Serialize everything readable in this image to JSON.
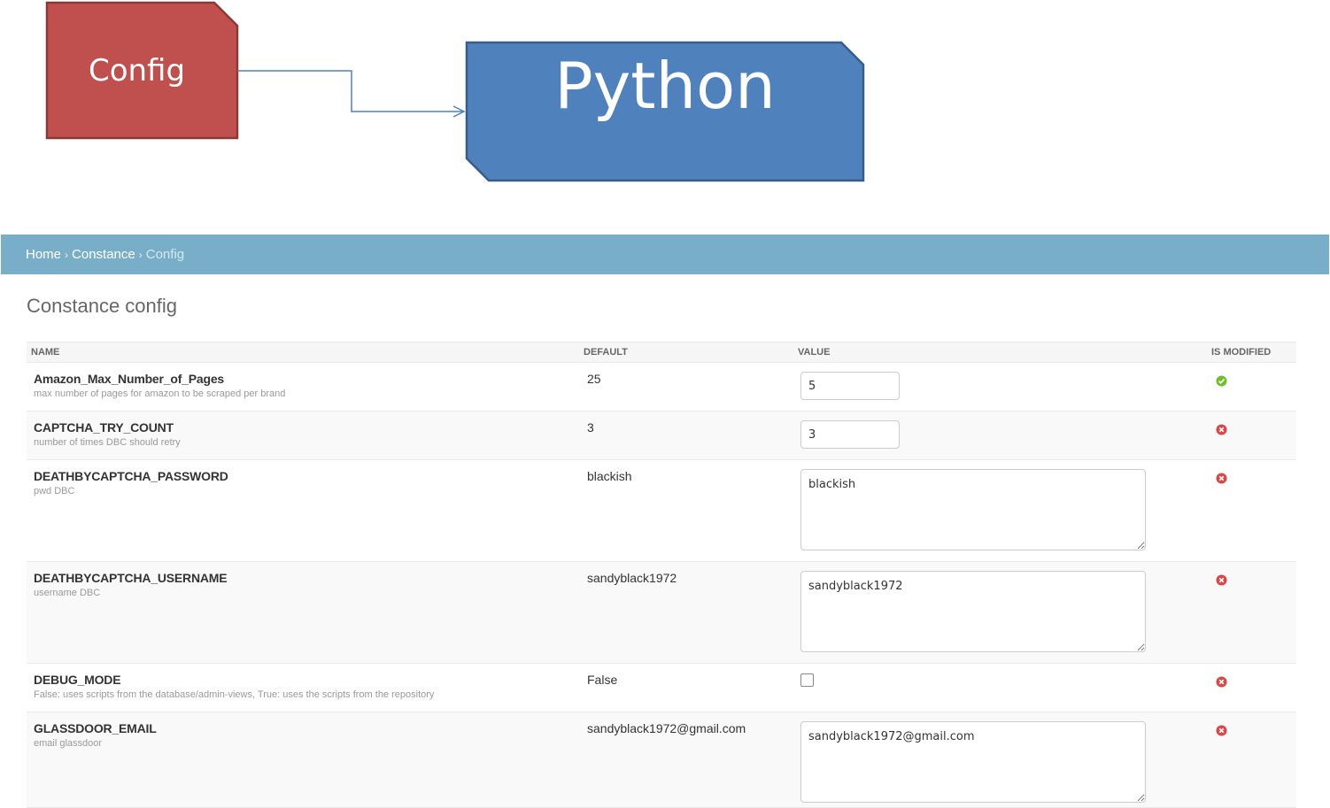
{
  "diagram": {
    "config_label": "Config",
    "python_label": "Python",
    "colors": {
      "config_fill": "#c0504d",
      "config_stroke": "#8c3836",
      "python_fill": "#4f81bd",
      "python_stroke": "#385d8a",
      "connector": "#4f81bd"
    }
  },
  "breadcrumbs": {
    "home": "Home",
    "constance": "Constance",
    "current": "Config",
    "separator": "›"
  },
  "page_title": "Constance config",
  "table": {
    "headers": {
      "name": "NAME",
      "default": "DEFAULT",
      "value": "VALUE",
      "is_modified": "IS MODIFIED"
    },
    "rows": [
      {
        "name": "Amazon_Max_Number_of_Pages",
        "help": "max number of pages for amazon to be scraped per brand",
        "default": "25",
        "value": "5",
        "widget": "input",
        "modified": true,
        "status_icon": "check-icon"
      },
      {
        "name": "CAPTCHA_TRY_COUNT",
        "help": "number of times DBC should retry",
        "default": "3",
        "value": "3",
        "widget": "input",
        "modified": false,
        "status_icon": "x-icon"
      },
      {
        "name": "DEATHBYCAPTCHA_PASSWORD",
        "help": "pwd DBC",
        "default": "blackish",
        "value": "blackish",
        "widget": "textarea",
        "modified": false,
        "status_icon": "x-icon"
      },
      {
        "name": "DEATHBYCAPTCHA_USERNAME",
        "help": "username DBC",
        "default": "sandyblack1972",
        "value": "sandyblack1972",
        "widget": "textarea",
        "modified": false,
        "status_icon": "x-icon"
      },
      {
        "name": "DEBUG_MODE",
        "help": "False: uses scripts from the database/admin-views, True: uses the scripts from the repository",
        "default": "False",
        "value": "",
        "widget": "checkbox",
        "checked": false,
        "modified": false,
        "status_icon": "x-icon"
      },
      {
        "name": "GLASSDOOR_EMAIL",
        "help": "email glassdoor",
        "default": "sandyblack1972@gmail.com",
        "value": "sandyblack1972@gmail.com",
        "widget": "textarea",
        "modified": false,
        "status_icon": "x-icon"
      }
    ]
  },
  "colors": {
    "breadcrumb_bg": "#79aec8",
    "modified_true": "#70bf2b",
    "modified_false": "#dd4646"
  }
}
